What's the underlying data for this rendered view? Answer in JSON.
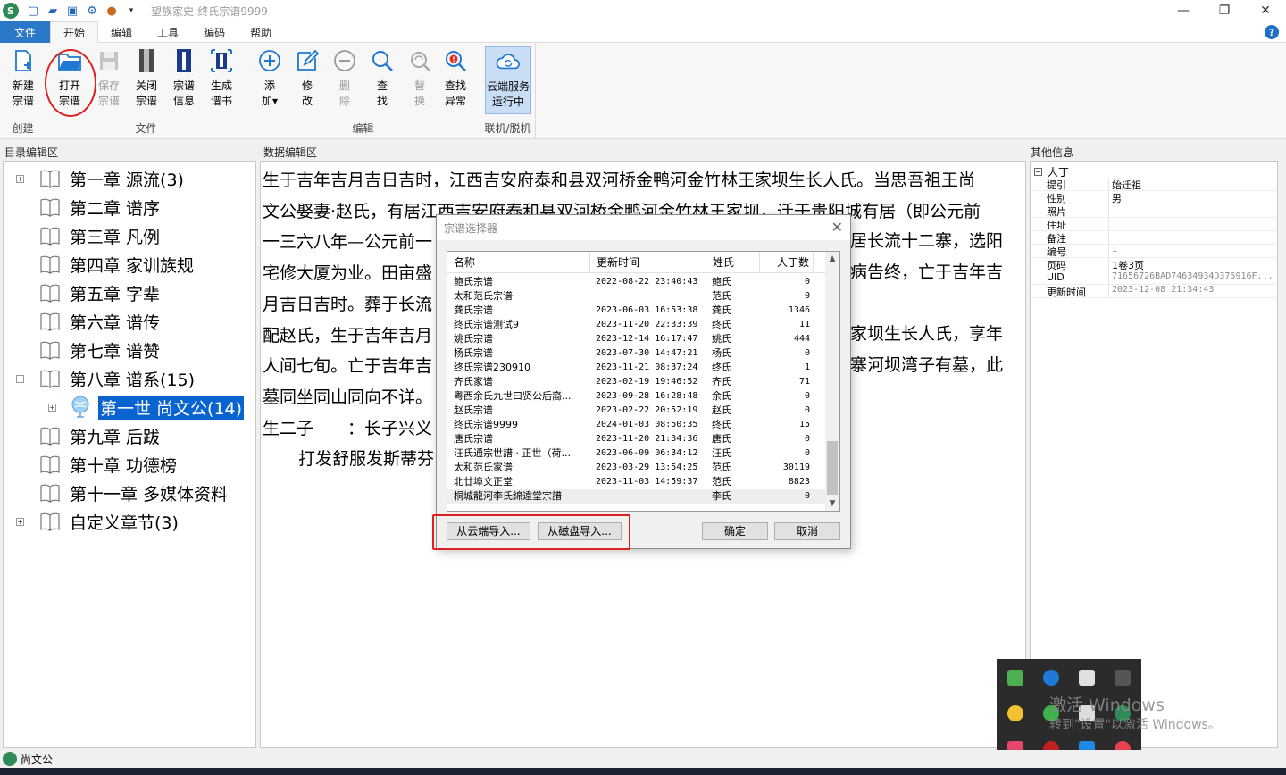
{
  "window": {
    "title": "望族家史-终氏宗谱9999"
  },
  "menu": {
    "file": "文件",
    "tabs": [
      "开始",
      "编辑",
      "工具",
      "编码",
      "帮助"
    ]
  },
  "ribbon": {
    "groups": {
      "create": "创建",
      "file": "文件",
      "edit": "编辑",
      "online": "联机/脱机"
    },
    "buttons": {
      "new": [
        "新建",
        "宗谱"
      ],
      "open": [
        "打开",
        "宗谱"
      ],
      "save": [
        "保存",
        "宗谱"
      ],
      "close": [
        "关闭",
        "宗谱"
      ],
      "info": [
        "宗谱",
        "信息"
      ],
      "gen": [
        "生成",
        "谱书"
      ],
      "add": [
        "添",
        "加▾"
      ],
      "modify": [
        "修",
        "改"
      ],
      "delete": [
        "删",
        "除"
      ],
      "find": [
        "查",
        "找"
      ],
      "replace": [
        "替",
        "换"
      ],
      "findErr": [
        "查找",
        "异常"
      ],
      "cloud": [
        "云端服务",
        "运行中"
      ]
    }
  },
  "panels": {
    "left": "目录编辑区",
    "middle": "数据编辑区",
    "right": "其他信息"
  },
  "tree": [
    {
      "label": "第一章 源流(3)",
      "expand": "+"
    },
    {
      "label": "第二章 谱序"
    },
    {
      "label": "第三章 凡例"
    },
    {
      "label": "第四章 家训族规"
    },
    {
      "label": "第五章 字辈"
    },
    {
      "label": "第六章 谱传"
    },
    {
      "label": "第七章 谱赞"
    },
    {
      "label": "第八章 谱系(15)",
      "expand": "−"
    },
    {
      "label": "第一世 尚文公(14)",
      "child": true,
      "selected": true,
      "expand": "+"
    },
    {
      "label": "第九章 后跋"
    },
    {
      "label": "第十章 功德榜"
    },
    {
      "label": "第十一章 多媒体资料"
    },
    {
      "label": "自定义章节(3)",
      "expand": "+"
    }
  ],
  "doc": {
    "lines": [
      "生于吉年吉月吉日吉时，江西吉安府泰和县双河桥金鸭河金竹林王家坝生长人氏。当思吾祖王尚",
      "文公娶妻·赵氏，有居江西吉安府泰和县双河桥金鸭河金竹林王家坝，迁于贵阳城有居（即公元前",
      "一三六八年—公元前一",
      "宅修大厦为业。田亩盛",
      "月吉日吉时。葬于长流",
      "配赵氏，生于吉年吉月",
      "人间七旬。亡于吉年吉",
      "墓同坐同山同向不详。",
      "生二子　　：长子兴义"
    ],
    "right_fragments": [
      "居长流十二寨，选阳",
      "病告终，亡于吉年吉",
      "家坝生长人氏，享年",
      "寨河坝湾子有墓，此"
    ],
    "extra": "打发舒服发斯蒂芬"
  },
  "properties": {
    "section": "人丁",
    "rows": [
      {
        "k": "提引",
        "v": "始迁祖"
      },
      {
        "k": "性别",
        "v": "男"
      },
      {
        "k": "照片",
        "v": ""
      },
      {
        "k": "住址",
        "v": ""
      },
      {
        "k": "备注",
        "v": ""
      },
      {
        "k": "编号",
        "v": "1",
        "gray": true
      },
      {
        "k": "页码",
        "v": "1卷3页"
      },
      {
        "k": "UID",
        "v": "71656726BAD74634934D375916F...",
        "gray": true
      },
      {
        "k": "更新时间",
        "v": "2023-12-08 21:34:43",
        "gray": true
      }
    ]
  },
  "dialog": {
    "title": "宗谱选择器",
    "headers": [
      "名称",
      "更新时间",
      "姓氏",
      "人丁数"
    ],
    "rows": [
      [
        "鲍氏宗谱",
        "2022-08-22 23:40:43",
        "鲍氏",
        "0"
      ],
      [
        "太和范氏宗谱",
        "",
        "范氏",
        "0"
      ],
      [
        "龚氏宗谱",
        "2023-06-03 16:53:38",
        "龚氏",
        "1346"
      ],
      [
        "终氏宗谱测试9",
        "2023-11-20 22:33:39",
        "终氏",
        "11"
      ],
      [
        "姚氏宗谱",
        "2023-12-14 16:17:47",
        "姚氏",
        "444"
      ],
      [
        "杨氏宗谱",
        "2023-07-30 14:47:21",
        "杨氏",
        "0"
      ],
      [
        "终氏宗谱230910",
        "2023-11-21 08:37:24",
        "终氏",
        "1"
      ],
      [
        "齐氏家谱",
        "2023-02-19 19:46:52",
        "齐氏",
        "71"
      ],
      [
        "粤西余氏九世曰贤公后裔...",
        "2023-09-28 16:28:48",
        "余氏",
        "0"
      ],
      [
        "赵氏宗谱",
        "2023-02-22 20:52:19",
        "赵氏",
        "0"
      ],
      [
        "终氏宗谱9999",
        "2024-01-03 08:50:35",
        "终氏",
        "15"
      ],
      [
        "唐氏宗谱",
        "2023-11-20 21:34:36",
        "唐氏",
        "0"
      ],
      [
        "汪氏通宗世譜 · 正世（荷...",
        "2023-06-09 06:34:12",
        "汪氏",
        "0"
      ],
      [
        "太和范氏家谱",
        "2023-03-29 13:54:25",
        "范氏",
        "30119"
      ],
      [
        "北廿埠文正堂",
        "2023-11-03 14:59:37",
        "范氏",
        "8823"
      ],
      [
        "桐城龍河李氏綿遠堂宗譜",
        "",
        "李氏",
        "0"
      ]
    ],
    "buttons": {
      "cloud_import": "从云端导入...",
      "disk_import": "从磁盘导入...",
      "ok": "确定",
      "cancel": "取消"
    }
  },
  "status": {
    "text": "尚文公"
  },
  "watermark": {
    "line1": "激活 Windows",
    "line2": "转到\"设置\"以激活 Windows。"
  }
}
